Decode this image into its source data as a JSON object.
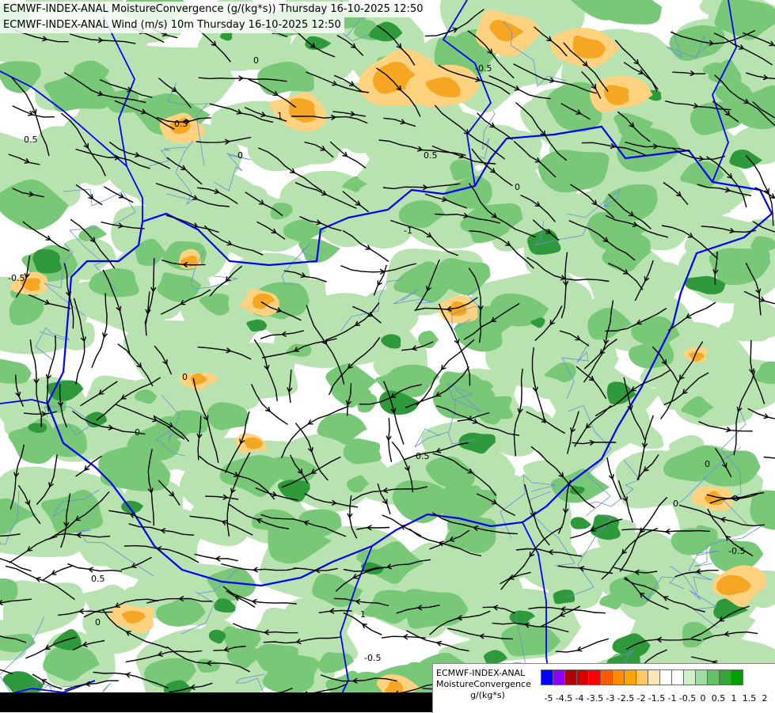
{
  "header": {
    "title_line1": "ECMWF-INDEX-ANAL MoistureConvergence (g/(kg*s)) Thursday 16-10-2025 12:50",
    "title_line2": "ECMWF-INDEX-ANAL Wind (m/s) 10m Thursday 16-10-2025 12:50"
  },
  "legend": {
    "line1": "ECMWF-INDEX-ANAL",
    "line2": "MoistureConvergence",
    "unit": "g/(kg*s)",
    "colors": [
      "#0000ff",
      "#8b00ff",
      "#b00000",
      "#d40000",
      "#ff0000",
      "#ff5a00",
      "#ff8c00",
      "#ffa500",
      "#ffc864",
      "#ffe6b4",
      "#ffffff",
      "#ffffff",
      "#d2f0c8",
      "#a0dca0",
      "#64c364",
      "#32a532",
      "#00a000"
    ],
    "ticks": [
      "-5",
      "-4.5",
      "-4",
      "-3.5",
      "-3",
      "-2.5",
      "-2",
      "-1.5",
      "-1",
      "-0.5",
      "0",
      "0.5",
      "1",
      "1.5",
      "2"
    ]
  },
  "map": {
    "contour_labels": [
      "0",
      "0.5",
      "-0.5",
      "1",
      "-1",
      "0",
      "0.5",
      "0",
      "-0.5",
      "0",
      "0.5",
      "0",
      "0.5",
      "1",
      "0",
      "-0.5",
      "0",
      "0.5",
      "-0.5",
      "0"
    ],
    "colors": {
      "border": "#0000ff",
      "river": "#6a8cd6",
      "streamline": "#000000",
      "green_light": "#b8e3b0",
      "green_mid": "#78c878",
      "green_dark": "#2e9a3c",
      "orange_light": "#ffd27f",
      "orange_mid": "#f5a623"
    }
  }
}
